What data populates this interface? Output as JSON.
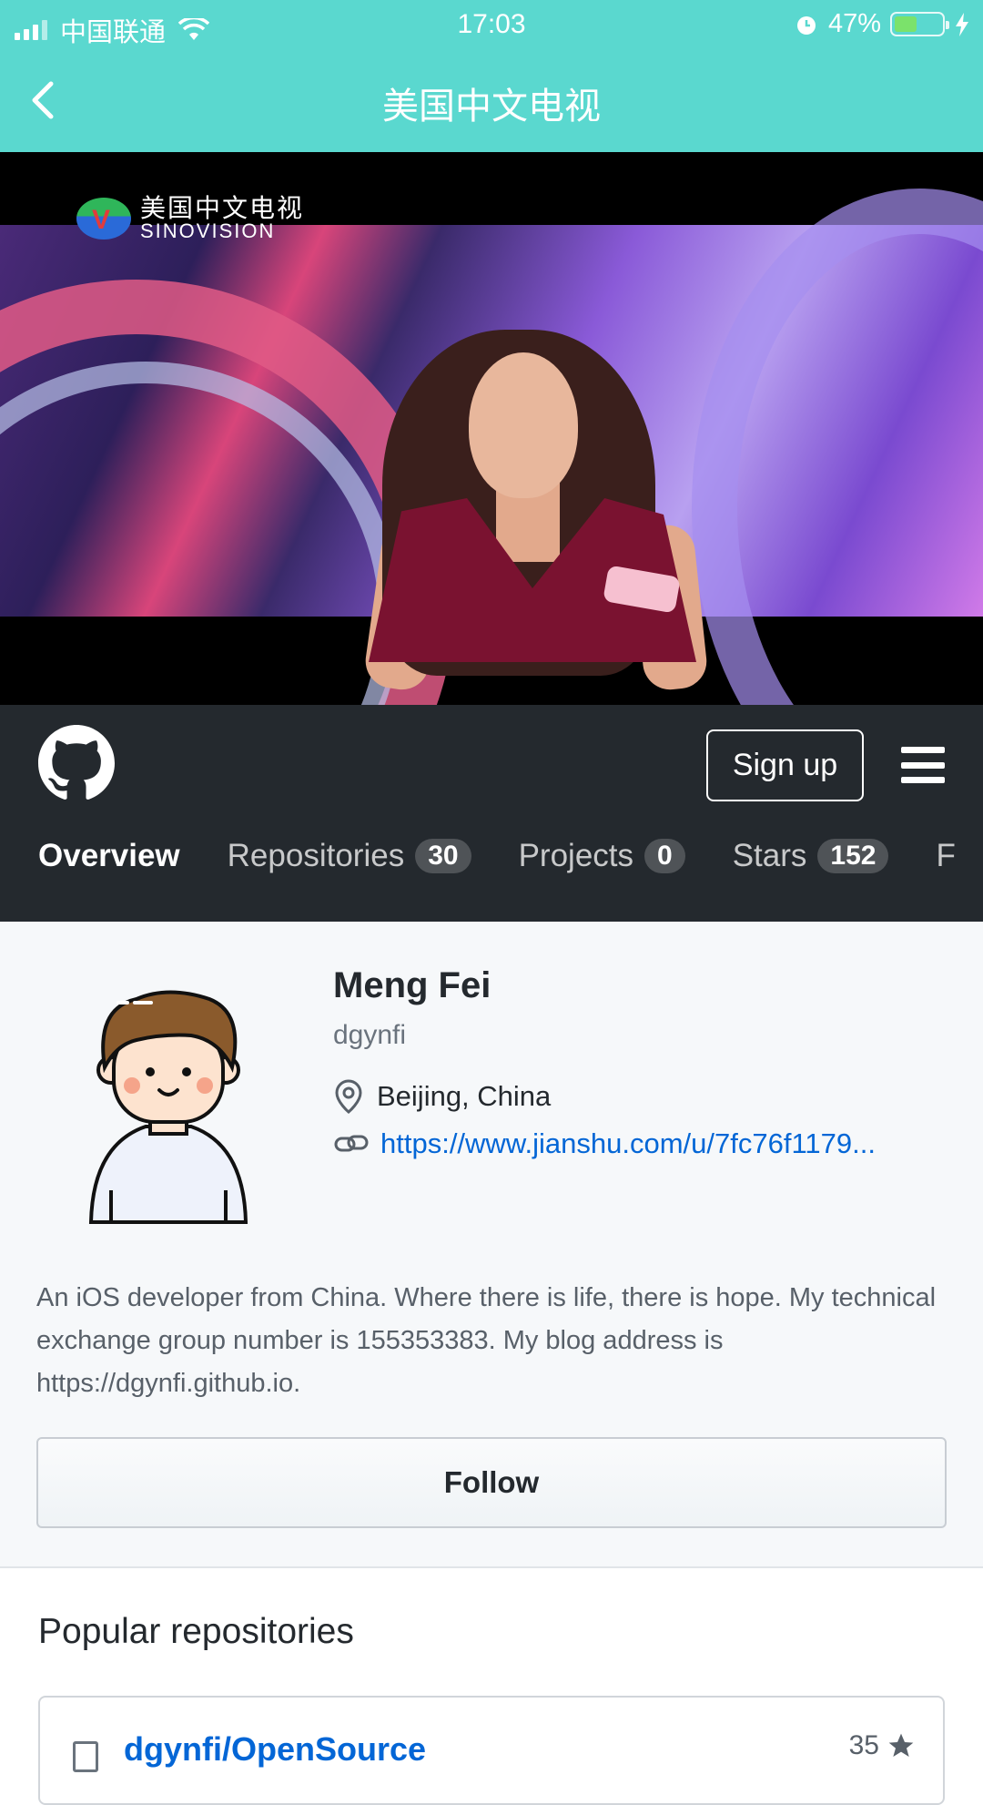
{
  "status_bar": {
    "carrier": "中国联通",
    "time": "17:03",
    "battery_percent": "47%",
    "battery_level": 0.47,
    "icons": [
      "signal-icon",
      "wifi-icon",
      "alarm-icon",
      "battery-icon",
      "charging-icon"
    ]
  },
  "nav": {
    "title": "美国中文电视",
    "back_icon": "chevron-left-icon"
  },
  "video": {
    "logo_cn": "美国中文电视",
    "logo_en": "SINOVISION"
  },
  "github": {
    "signup_label": "Sign up",
    "tabs": [
      {
        "label": "Overview",
        "count": null,
        "active": true
      },
      {
        "label": "Repositories",
        "count": "30"
      },
      {
        "label": "Projects",
        "count": "0"
      },
      {
        "label": "Stars",
        "count": "152"
      }
    ],
    "tab_overflow": "F"
  },
  "profile": {
    "name": "Meng Fei",
    "login": "dgynfi",
    "location": "Beijing, China",
    "link": "https://www.jianshu.com/u/7fc76f1179...",
    "bio": "An iOS developer from China. Where there is life, there is hope. My technical exchange group number is 155353383. My blog address is https://dgynfi.github.io.",
    "follow_label": "Follow"
  },
  "popular": {
    "heading": "Popular repositories",
    "repos": [
      {
        "name": "dgynfi/OpenSource",
        "stars": "35"
      }
    ]
  },
  "colors": {
    "header_teal": "#5ad8cf",
    "github_dark": "#24292e",
    "link_blue": "#0366d6"
  }
}
